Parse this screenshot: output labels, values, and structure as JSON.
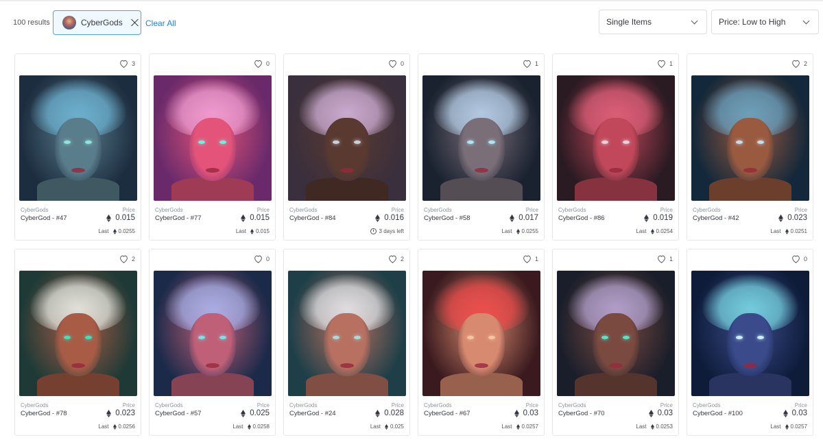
{
  "toolbar": {
    "results_count": "100 results",
    "filter_chip_label": "CyberGods",
    "clear_all_label": "Clear All",
    "item_type_select": "Single Items",
    "sort_select": "Price: Low to High"
  },
  "labels": {
    "price": "Price",
    "last": "Last"
  },
  "cards": [
    {
      "collection": "CyberGods",
      "name": "CyberGod - #47",
      "likes": "3",
      "price": "0.015",
      "last": "0.0255",
      "palette": [
        "#1c2d3f",
        "#6fb6d6",
        "#5a7d8c",
        "#8fe3d8"
      ]
    },
    {
      "collection": "CyberGods",
      "name": "CyberGod - #77",
      "likes": "0",
      "price": "0.015",
      "last": "0.015",
      "palette": [
        "#6a2a6a",
        "#f2a3d8",
        "#e4547a",
        "#6ff0d8"
      ]
    },
    {
      "collection": "CyberGods",
      "name": "CyberGod - #84",
      "likes": "0",
      "price": "0.016",
      "time_left": "3 days left",
      "palette": [
        "#3a2f3c",
        "#d7b6e0",
        "#5a3a30",
        "#c9d0d6"
      ]
    },
    {
      "collection": "CyberGods",
      "name": "CyberGod - #58",
      "likes": "1",
      "price": "0.017",
      "last": "0.0255",
      "palette": [
        "#1a2230",
        "#b9d4ee",
        "#7a6e78",
        "#a8e6f0"
      ]
    },
    {
      "collection": "CyberGods",
      "name": "CyberGod - #86",
      "likes": "1",
      "price": "0.019",
      "last": "0.0254",
      "palette": [
        "#2a1a22",
        "#e0607a",
        "#c0485a",
        "#e8d2d8"
      ]
    },
    {
      "collection": "CyberGods",
      "name": "CyberGod - #42",
      "likes": "2",
      "price": "0.023",
      "last": "0.0251",
      "palette": [
        "#13283a",
        "#6aa8c8",
        "#9a5a40",
        "#bfe0ea"
      ]
    },
    {
      "collection": "CyberGods",
      "name": "CyberGod - #78",
      "likes": "2",
      "price": "0.023",
      "last": "0.0256",
      "palette": [
        "#1f3a36",
        "#e8f0ea",
        "#a85c46",
        "#3fe0c0"
      ]
    },
    {
      "collection": "CyberGods",
      "name": "CyberGod - #57",
      "likes": "0",
      "price": "0.025",
      "last": "0.0258",
      "palette": [
        "#1c2a4a",
        "#aab6f0",
        "#c06078",
        "#7ae0e8"
      ]
    },
    {
      "collection": "CyberGods",
      "name": "CyberGod - #24",
      "likes": "2",
      "price": "0.028",
      "last": "0.025",
      "palette": [
        "#1e3f48",
        "#e6eaee",
        "#b87060",
        "#a8d8e0"
      ]
    },
    {
      "collection": "CyberGods",
      "name": "CyberGod - #67",
      "likes": "1",
      "price": "0.03",
      "last": "0.0257",
      "palette": [
        "#3a1a1e",
        "#f04a4a",
        "#d88a70",
        "#f0c8a0"
      ]
    },
    {
      "collection": "CyberGods",
      "name": "CyberGod - #70",
      "likes": "1",
      "price": "0.03",
      "last": "0.0253",
      "palette": [
        "#1a1e2a",
        "#b8a8d8",
        "#7a4a40",
        "#5ae0c8"
      ]
    },
    {
      "collection": "CyberGods",
      "name": "CyberGod - #100",
      "likes": "0",
      "price": "0.03",
      "last": "0.0257",
      "palette": [
        "#0e1c3a",
        "#7adbe6",
        "#3a4a8a",
        "#c8f0f8"
      ]
    }
  ],
  "colors": {
    "accent": "#2081e2",
    "chip_border": "#4fa6d9",
    "text": "#353840",
    "muted": "#8a939b"
  }
}
